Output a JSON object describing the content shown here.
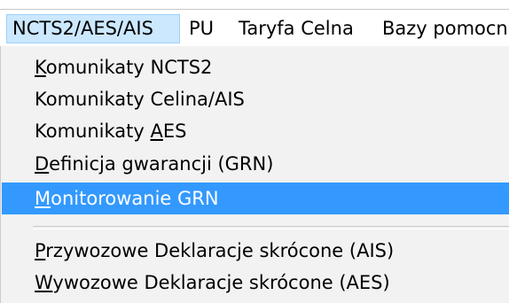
{
  "menubar": {
    "items": [
      {
        "label": "NCTS2/AES/AIS"
      },
      {
        "label": "PU"
      },
      {
        "label": "Taryfa Celna"
      },
      {
        "label": "Bazy pomocn"
      }
    ]
  },
  "dropdown": {
    "items": [
      {
        "mnemonic": "K",
        "rest": "omunikaty NCTS2"
      },
      {
        "mnemonic": "",
        "rest": "Komunikaty Celina/AIS"
      },
      {
        "prefix": "Komunikaty ",
        "mnemonic": "A",
        "rest": "ES"
      },
      {
        "mnemonic": "D",
        "rest": "efinicja gwarancji (GRN)"
      },
      {
        "mnemonic": "M",
        "rest": "onitorowanie GRN"
      },
      {
        "mnemonic": "P",
        "rest": "rzywozowe Deklaracje skrócone (AIS)"
      },
      {
        "mnemonic": "W",
        "rest": "ywozowe Deklaracje skrócone (AES)"
      }
    ]
  },
  "colors": {
    "highlight": "#3399ff",
    "menubar_active": "#cce8ff",
    "menu_background": "#f2f2f2"
  }
}
